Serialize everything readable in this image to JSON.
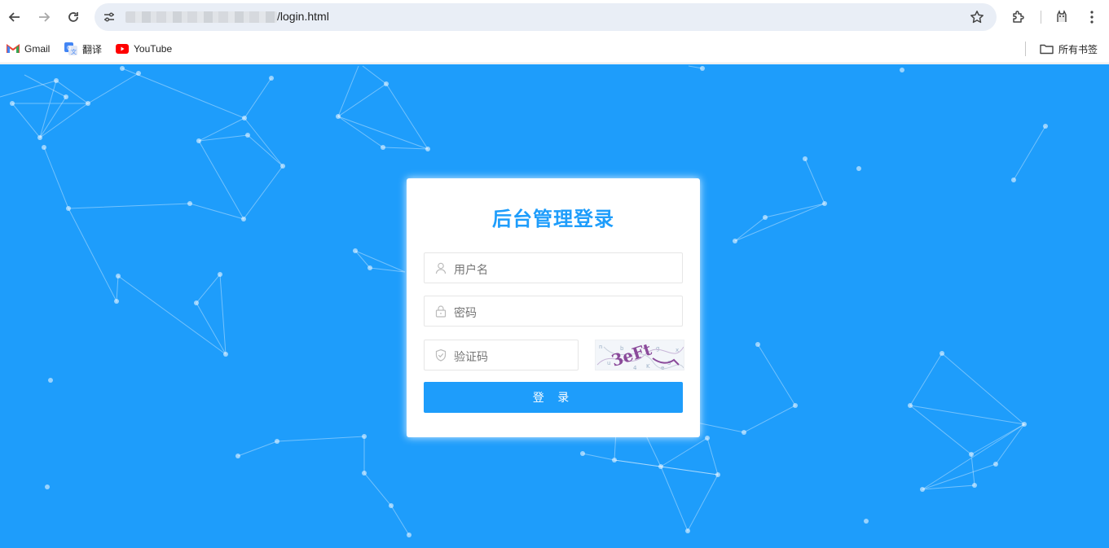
{
  "browser": {
    "url_suffix": "/login.html",
    "bookmarks": [
      {
        "label": "Gmail",
        "icon": "gmail-icon"
      },
      {
        "label": "翻译",
        "icon": "translate-icon"
      },
      {
        "label": "YouTube",
        "icon": "youtube-icon"
      }
    ],
    "all_bookmarks_label": "所有书签"
  },
  "login": {
    "title": "后台管理登录",
    "username_placeholder": "用户名",
    "password_placeholder": "密码",
    "captcha_placeholder": "验证码",
    "captcha_text": "3eFt",
    "submit_label": "登 录"
  },
  "colors": {
    "background": "#1e9dfb",
    "accent": "#1e9dfb",
    "card": "#ffffff"
  }
}
